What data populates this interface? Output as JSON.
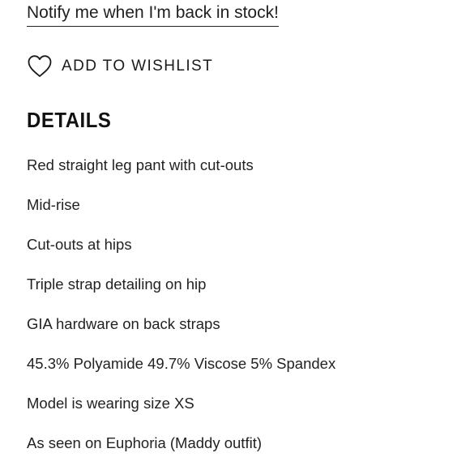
{
  "notify": {
    "label": "Notify me when I'm back in stock!"
  },
  "wishlist": {
    "label": "ADD TO WISHLIST",
    "icon": "heart-icon"
  },
  "details": {
    "title": "DETAILS",
    "items": [
      "Red straight leg pant with cut-outs",
      "Mid-rise",
      "Cut-outs at hips",
      "Triple strap detailing on hip",
      "GIA hardware on back straps",
      "45.3% Polyamide 49.7% Viscose 5% Spandex",
      "Model is wearing size XS",
      "As seen on Euphoria (Maddy outfit)"
    ]
  },
  "colors": {
    "text": "#1a1a1a",
    "background": "#ffffff"
  }
}
